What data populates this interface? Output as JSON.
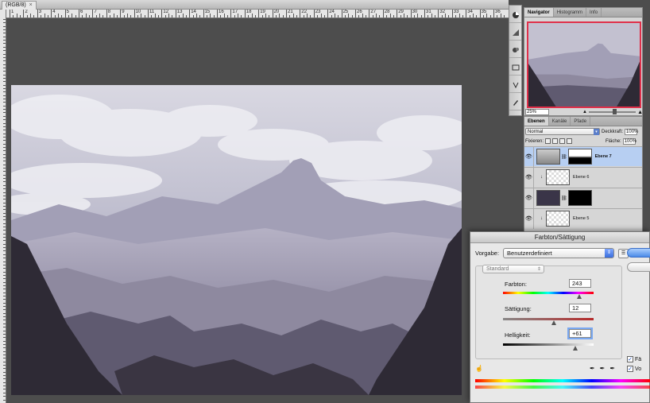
{
  "document": {
    "tab_title": "(RGB/8)",
    "close_glyph": "×",
    "ruler_numbers": [
      "1",
      "2",
      "3",
      "4",
      "5",
      "6",
      "7",
      "8",
      "9",
      "10",
      "11",
      "12",
      "13",
      "14",
      "15",
      "16",
      "17",
      "18",
      "19",
      "20",
      "21",
      "22",
      "23",
      "24",
      "25",
      "26",
      "27",
      "28",
      "29",
      "30",
      "31",
      "32",
      "33",
      "34",
      "35",
      "36"
    ]
  },
  "navigator": {
    "tabs": [
      "Navigator",
      "Histogramm",
      "Info"
    ],
    "zoom": "25%",
    "frame_color": "#e0304a"
  },
  "layers": {
    "tabs": [
      "Ebenen",
      "Kanäle",
      "Pfade"
    ],
    "blend_mode": "Normal",
    "opacity_label": "Deckkraft:",
    "opacity_value": "100%",
    "lock_label": "Fixieren:",
    "fill_label": "Fläche:",
    "fill_value": "100%",
    "items": [
      {
        "name": "Ebene 7",
        "selected": true
      },
      {
        "name": "Ebene 6",
        "selected": false
      },
      {
        "name": "",
        "selected": false
      },
      {
        "name": "Ebene 5",
        "selected": false
      }
    ]
  },
  "dialog": {
    "title": "Farbton/Sättigung",
    "preset_label": "Vorgabe:",
    "preset_value": "Benutzerdefiniert",
    "channel": "Standard",
    "hue_label": "Farbton:",
    "hue_value": "243",
    "hue_level": 0.84,
    "saturation_label": "Sättigung:",
    "saturation_value": "12",
    "saturation_level": 0.56,
    "lightness_label": "Helligkeit:",
    "lightness_value": "+61",
    "lightness_level": 0.8,
    "colorize_label": "Fä",
    "preview_label": "Vo",
    "check_glyph": "✓"
  }
}
